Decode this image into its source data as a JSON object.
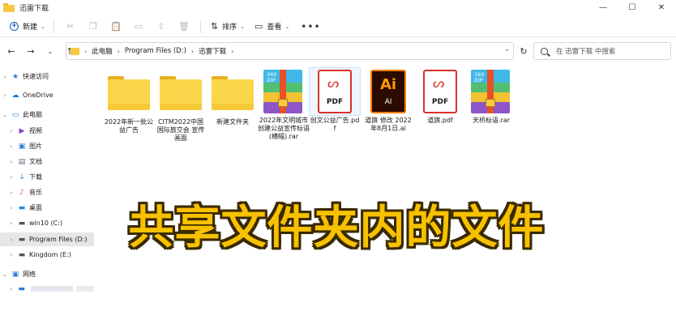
{
  "window": {
    "title": "迅雷下载",
    "controls": [
      "—",
      "☐",
      "✕"
    ]
  },
  "toolbar": {
    "new_label": "新建",
    "sort_label": "排序",
    "view_label": "查看",
    "more_label": "•••"
  },
  "address": {
    "crumbs": [
      "此电脑",
      "Program Files (D:)",
      "迅雷下载"
    ],
    "search_placeholder": "在 迅雷下载 中搜索"
  },
  "sidebar": {
    "items": [
      {
        "label": "快速访问",
        "icon": "star-icon"
      },
      {
        "label": "OneDrive",
        "icon": "cloud-icon"
      },
      {
        "label": "此电脑",
        "icon": "pc-icon"
      },
      {
        "label": "视频",
        "icon": "video-icon"
      },
      {
        "label": "图片",
        "icon": "picture-icon"
      },
      {
        "label": "文档",
        "icon": "document-icon"
      },
      {
        "label": "下载",
        "icon": "download-icon"
      },
      {
        "label": "音乐",
        "icon": "music-icon"
      },
      {
        "label": "桌面",
        "icon": "desktop-icon"
      },
      {
        "label": "win10 (C:)",
        "icon": "drive-icon"
      },
      {
        "label": "Program Files (D:)",
        "icon": "drive-icon"
      },
      {
        "label": "Kingdom (E:)",
        "icon": "drive-icon"
      },
      {
        "label": "网络",
        "icon": "network-icon"
      }
    ]
  },
  "files": [
    {
      "name": "2022年新一批公益广告",
      "type": "folder"
    },
    {
      "name": "CITM2022中国国际旅交会 宣传画面",
      "type": "folder"
    },
    {
      "name": "新建文件夹",
      "type": "folder"
    },
    {
      "name": "2022年文明城市创建公益宣传标语(横幅).rar",
      "type": "rar"
    },
    {
      "name": "创文公益广告.pdf",
      "type": "pdf"
    },
    {
      "name": "道旗 修改 2022年8月1日.ai",
      "type": "ai"
    },
    {
      "name": "道旗.pdf",
      "type": "pdf"
    },
    {
      "name": "天桥标语.rar",
      "type": "rar"
    }
  ],
  "icon_text": {
    "pdf": "PDF",
    "ai_big": "Ai",
    "ai_small": "AI",
    "zip": "360\nZIP"
  },
  "overlay": {
    "caption": "共享文件夹内的文件",
    "color": "#f7c100"
  }
}
